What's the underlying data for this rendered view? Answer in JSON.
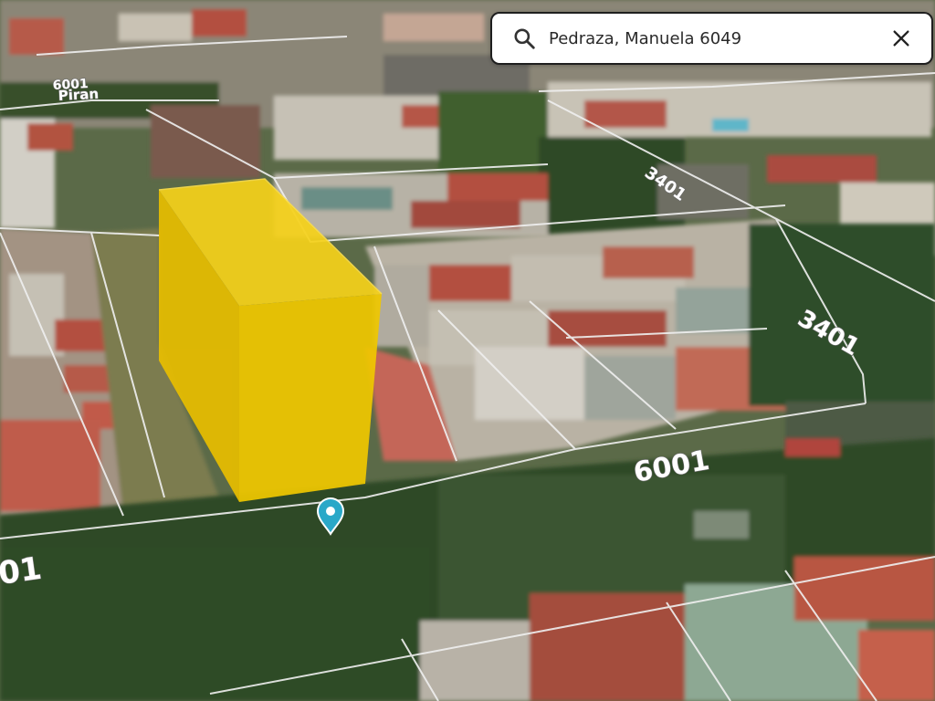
{
  "search": {
    "query": "Pedraza, Manuela 6049",
    "icon": "search-icon",
    "clear_icon": "close-icon"
  },
  "map": {
    "labels": {
      "top_left_number": "6001",
      "top_left_street": "Piran",
      "right_upper": "3401",
      "right_middle": "3401",
      "bottom_center": "6001",
      "bottom_left": "01"
    },
    "colors": {
      "building": "#f2c800",
      "marker": "#2aa8c8",
      "parcel_line": "#f0f0f0"
    },
    "marker_icon": "location-pin-icon"
  }
}
